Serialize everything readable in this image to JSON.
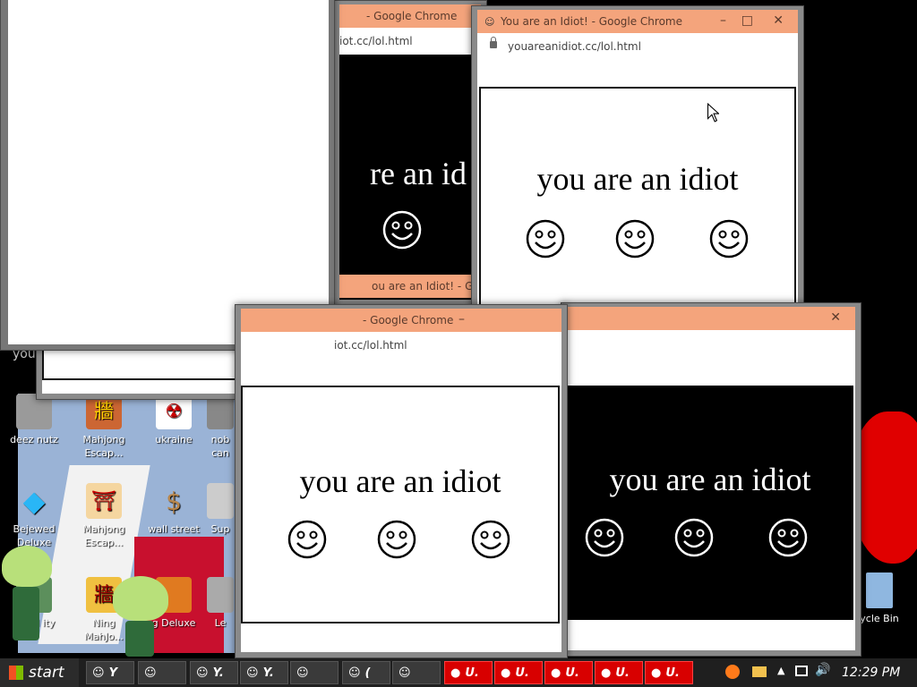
{
  "windows": {
    "main_title": "You are an Idiot! - Google Chrome",
    "url": "youareanidiot.cc/lol.html",
    "url_partial": "iot.cc/lol.html",
    "title_partial": "- Google Chrome",
    "title_partial2": "ou are an Idiot! - Go",
    "message": "you are an idiot",
    "message_partial": "re an id"
  },
  "desktop": {
    "icons": [
      {
        "label": "deez nutz",
        "icon": "folder-icon"
      },
      {
        "label": "Mahjong Escap...",
        "icon": "mahjong-icon"
      },
      {
        "label": "ukraine",
        "icon": "radiation-icon"
      },
      {
        "label": "nob can",
        "icon": "app-icon"
      },
      {
        "label": "Bejewed Deluxe",
        "icon": "gem-icon"
      },
      {
        "label": "Mahjong Escap...",
        "icon": "torii-icon"
      },
      {
        "label": "wall street",
        "icon": "money-bag-icon"
      },
      {
        "label": "Sup",
        "icon": "app-icon"
      },
      {
        "label": "ewed ity",
        "icon": "gem-icon"
      },
      {
        "label": "Ning MahJo...",
        "icon": "mahjong-icon"
      },
      {
        "label": "g Deluxe",
        "icon": "game-icon"
      },
      {
        "label": "Le",
        "icon": "app-icon"
      },
      {
        "label": "ycle Bin",
        "icon": "recycle-bin-icon"
      }
    ],
    "you_label": "you"
  },
  "taskbar": {
    "start_label": "start",
    "clock": "12:29 PM",
    "items": [
      {
        "label": "Y",
        "style": "dark"
      },
      {
        "label": "",
        "style": "dark"
      },
      {
        "label": "Y.",
        "style": "dark"
      },
      {
        "label": "Y.",
        "style": "dark"
      },
      {
        "label": "",
        "style": "dark"
      },
      {
        "label": "(",
        "style": "dark"
      },
      {
        "label": "",
        "style": "dark"
      },
      {
        "label": "U.",
        "style": "red"
      },
      {
        "label": "U.",
        "style": "red"
      },
      {
        "label": "U.",
        "style": "red"
      },
      {
        "label": "U.",
        "style": "red"
      },
      {
        "label": "U.",
        "style": "red"
      }
    ]
  },
  "colors": {
    "titlebar": "#f4a47c",
    "taskbar_red": "#d80000",
    "desktop_red": "#e00000"
  }
}
